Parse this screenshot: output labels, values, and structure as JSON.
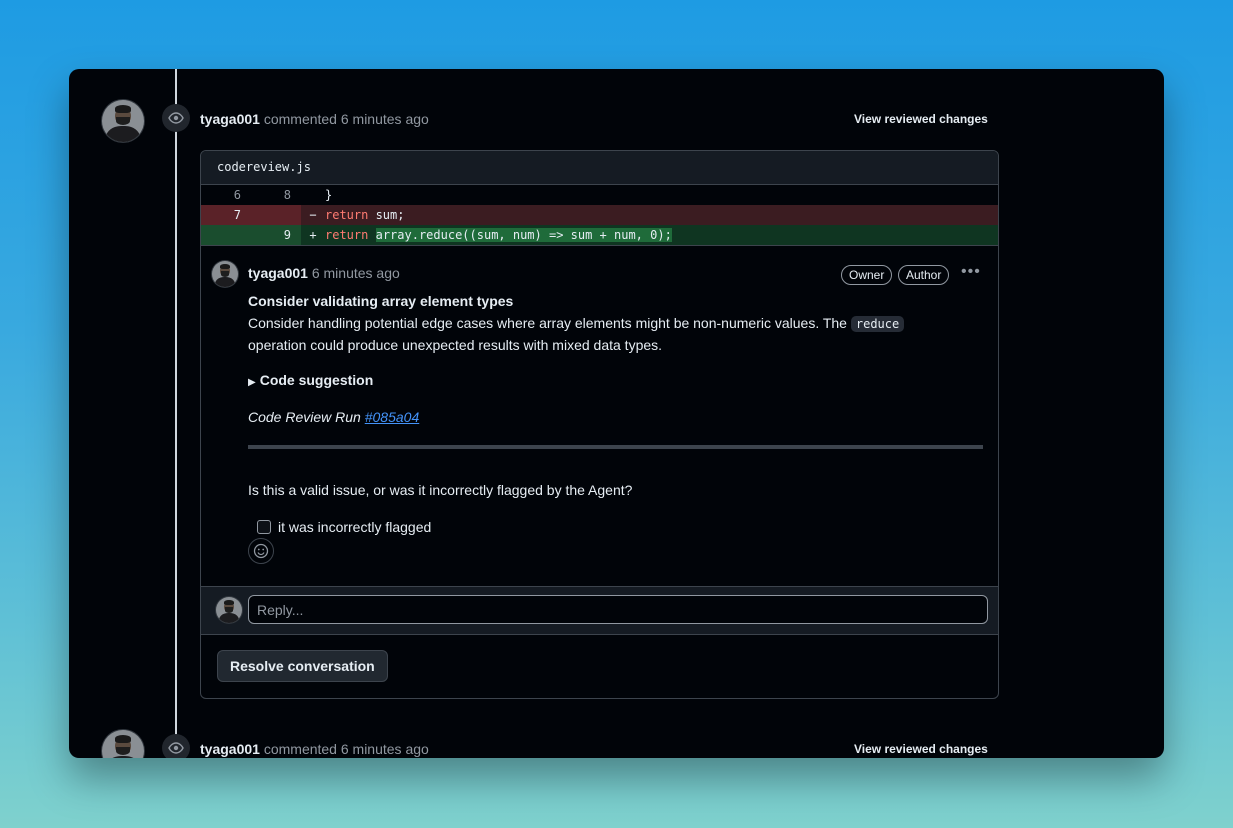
{
  "timeline": [
    {
      "author": "tyaga001",
      "action": "commented 6 minutes ago",
      "view_label": "View reviewed changes"
    },
    {
      "author": "tyaga001",
      "action": "commented 6 minutes ago",
      "view_label": "View reviewed changes"
    }
  ],
  "file": {
    "name": "codereview.js",
    "diff": [
      {
        "old": "6",
        "new": "8",
        "sign": "",
        "code_kw": "",
        "code_rest": "}",
        "type": "context"
      },
      {
        "old": "7",
        "new": "",
        "sign": "−",
        "code_kw": "return",
        "code_rest": " sum;",
        "type": "del"
      },
      {
        "old": "",
        "new": "9",
        "sign": "+",
        "code_kw": "return",
        "code_rest": "array.reduce((sum, num) => sum + num, 0);",
        "type": "add"
      }
    ]
  },
  "comment": {
    "author": "tyaga001",
    "time": "6 minutes ago",
    "labels": [
      "Owner",
      "Author"
    ],
    "more_icon": "kebab-horizontal",
    "title": "Consider validating array element types",
    "body_before": "Consider handling potential edge cases where array elements might be non-numeric values. The ",
    "body_code": "reduce",
    "body_after": " operation could produce unexpected results with mixed data types.",
    "details_label": "Code suggestion",
    "run_prefix": "Code Review Run ",
    "run_link": "#085a04",
    "question": "Is this a valid issue, or was it incorrectly flagged by the Agent?",
    "checkbox_label": "it was incorrectly flagged"
  },
  "reply": {
    "placeholder": "Reply..."
  },
  "resolve_label": "Resolve conversation",
  "colors": {
    "background_top": "#1e9be3",
    "background_bottom": "#7fd1cd",
    "link": "#4493f8",
    "del": "#3b1c21",
    "add": "#0f3521"
  }
}
